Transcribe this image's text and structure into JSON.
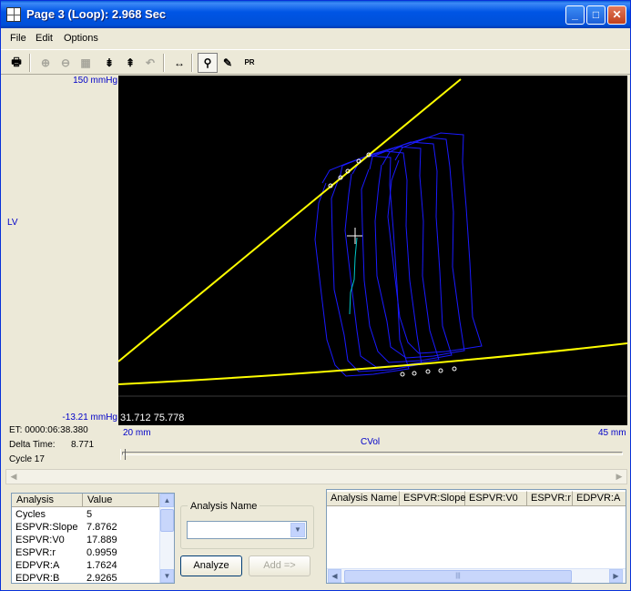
{
  "window": {
    "title": "Page 3 (Loop): 2.968 Sec",
    "minimize_label": "_",
    "maximize_label": "□",
    "close_label": "✕"
  },
  "menu": {
    "items": [
      "File",
      "Edit",
      "Options"
    ]
  },
  "toolbar": {
    "buttons": [
      {
        "name": "print-icon",
        "glyph": "🖶",
        "enabled": true
      },
      {
        "name": "zoom-in-icon",
        "glyph": "⊕",
        "enabled": false
      },
      {
        "name": "zoom-out-icon",
        "glyph": "⊖",
        "enabled": false
      },
      {
        "name": "fit-icon",
        "glyph": "▦",
        "enabled": false
      },
      {
        "name": "expand-icon",
        "glyph": "⇟",
        "enabled": true
      },
      {
        "name": "compress-icon",
        "glyph": "⇞",
        "enabled": true
      },
      {
        "name": "undo-icon",
        "glyph": "↶",
        "enabled": false
      },
      {
        "name": "pan-horizontal-icon",
        "glyph": "↔",
        "enabled": true
      },
      {
        "name": "cursor-tool-icon",
        "glyph": "⚲",
        "enabled": true
      },
      {
        "name": "eraser-icon",
        "glyph": "✎",
        "enabled": true
      },
      {
        "name": "pr-sw-icon",
        "glyph": "PR",
        "enabled": true
      }
    ]
  },
  "plot": {
    "y_max_label": "150 mmHg",
    "y_min_label": "-13.21 mmHg",
    "y_channel_label": "LV",
    "x_min_label": "20 mm",
    "x_max_label": "45 mm",
    "x_channel_label": "CVol",
    "cursor_readout": "31.712  75.778",
    "colors": {
      "background": "#000000",
      "loops": "#1a1aff",
      "fit_lines": "#ffff00",
      "selected_segment": "#00c8c8"
    }
  },
  "status": {
    "et_label": "ET: 0000:06:38.380",
    "delta_label": "Delta Time:",
    "delta_value": "8.771",
    "cycle_label": "Cycle 17"
  },
  "analysis_table": {
    "headers": [
      "Analysis",
      "Value"
    ],
    "rows": [
      [
        "Cycles",
        "5"
      ],
      [
        "ESPVR:Slope",
        "7.8762"
      ],
      [
        "ESPVR:V0",
        "17.889"
      ],
      [
        "ESPVR:r",
        "0.9959"
      ],
      [
        "EDPVR:A",
        "1.7624"
      ],
      [
        "EDPVR:B",
        "2.9265"
      ]
    ]
  },
  "analysis_name": {
    "group_label": "Analysis Name",
    "selected_value": "",
    "analyze_label": "Analyze",
    "add_label": "Add =>"
  },
  "results_table": {
    "headers": [
      "Analysis Name",
      "ESPVR:Slope",
      "ESPVR:V0",
      "ESPVR:r",
      "EDPVR:A"
    ],
    "scroll_thumb_label": "|||"
  }
}
